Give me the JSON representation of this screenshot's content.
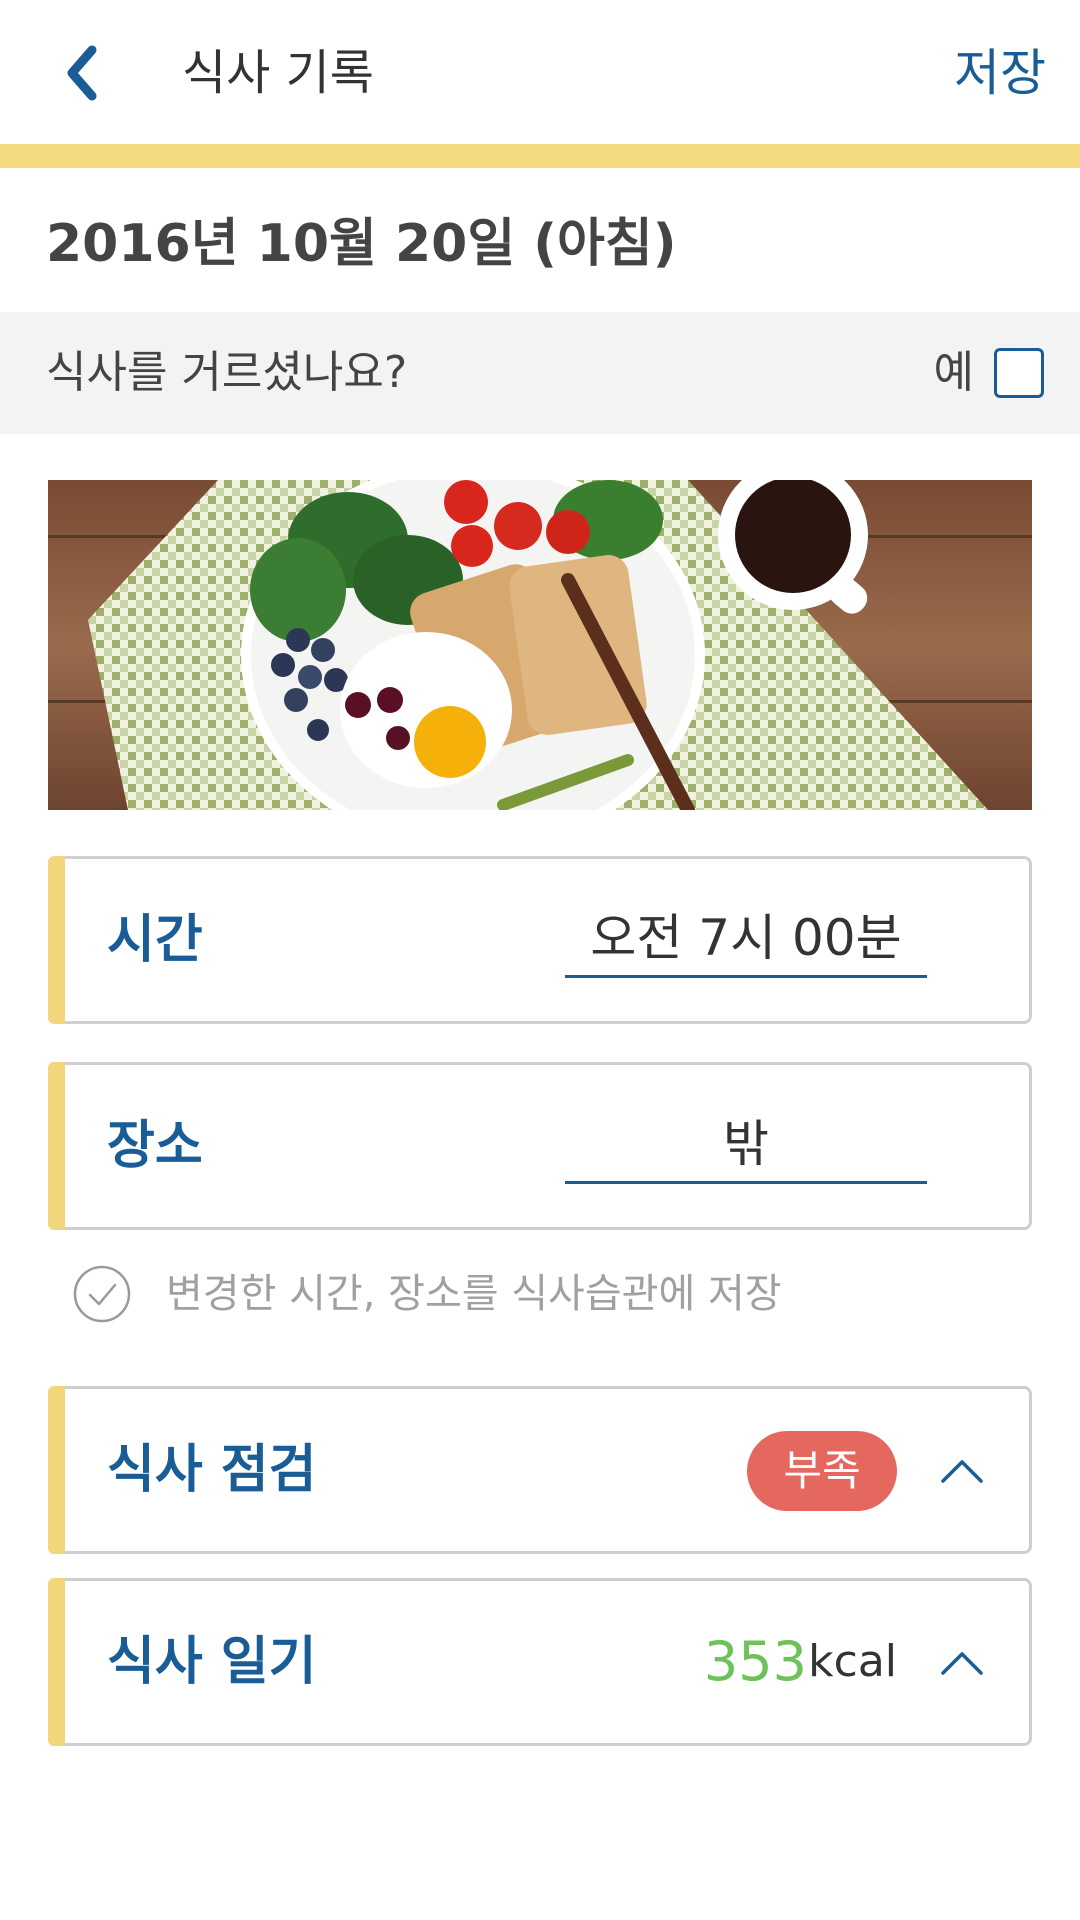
{
  "header": {
    "title": "식사 기록",
    "save_label": "저장",
    "back_icon": "chevron-left-icon"
  },
  "date_label": "2016년 10월 20일 (아침)",
  "skip": {
    "question": "식사를 거르셨나요?",
    "yes_label": "예",
    "checked": false
  },
  "time": {
    "label": "시간",
    "value": "오전 7시 00분"
  },
  "place": {
    "label": "장소",
    "value": "밖"
  },
  "habit_save": {
    "text": "변경한 시간, 장소를 식사습관에 저장",
    "checked": false
  },
  "meal_check": {
    "label": "식사 점검",
    "badge": "부족",
    "badge_color": "#e5685f"
  },
  "meal_diary": {
    "label": "식사 일기",
    "kcal_value": "353",
    "kcal_unit": "kcal",
    "kcal_color": "#6dc25a"
  },
  "colors": {
    "accent": "#f3d97f",
    "primary": "#1a5c96"
  }
}
